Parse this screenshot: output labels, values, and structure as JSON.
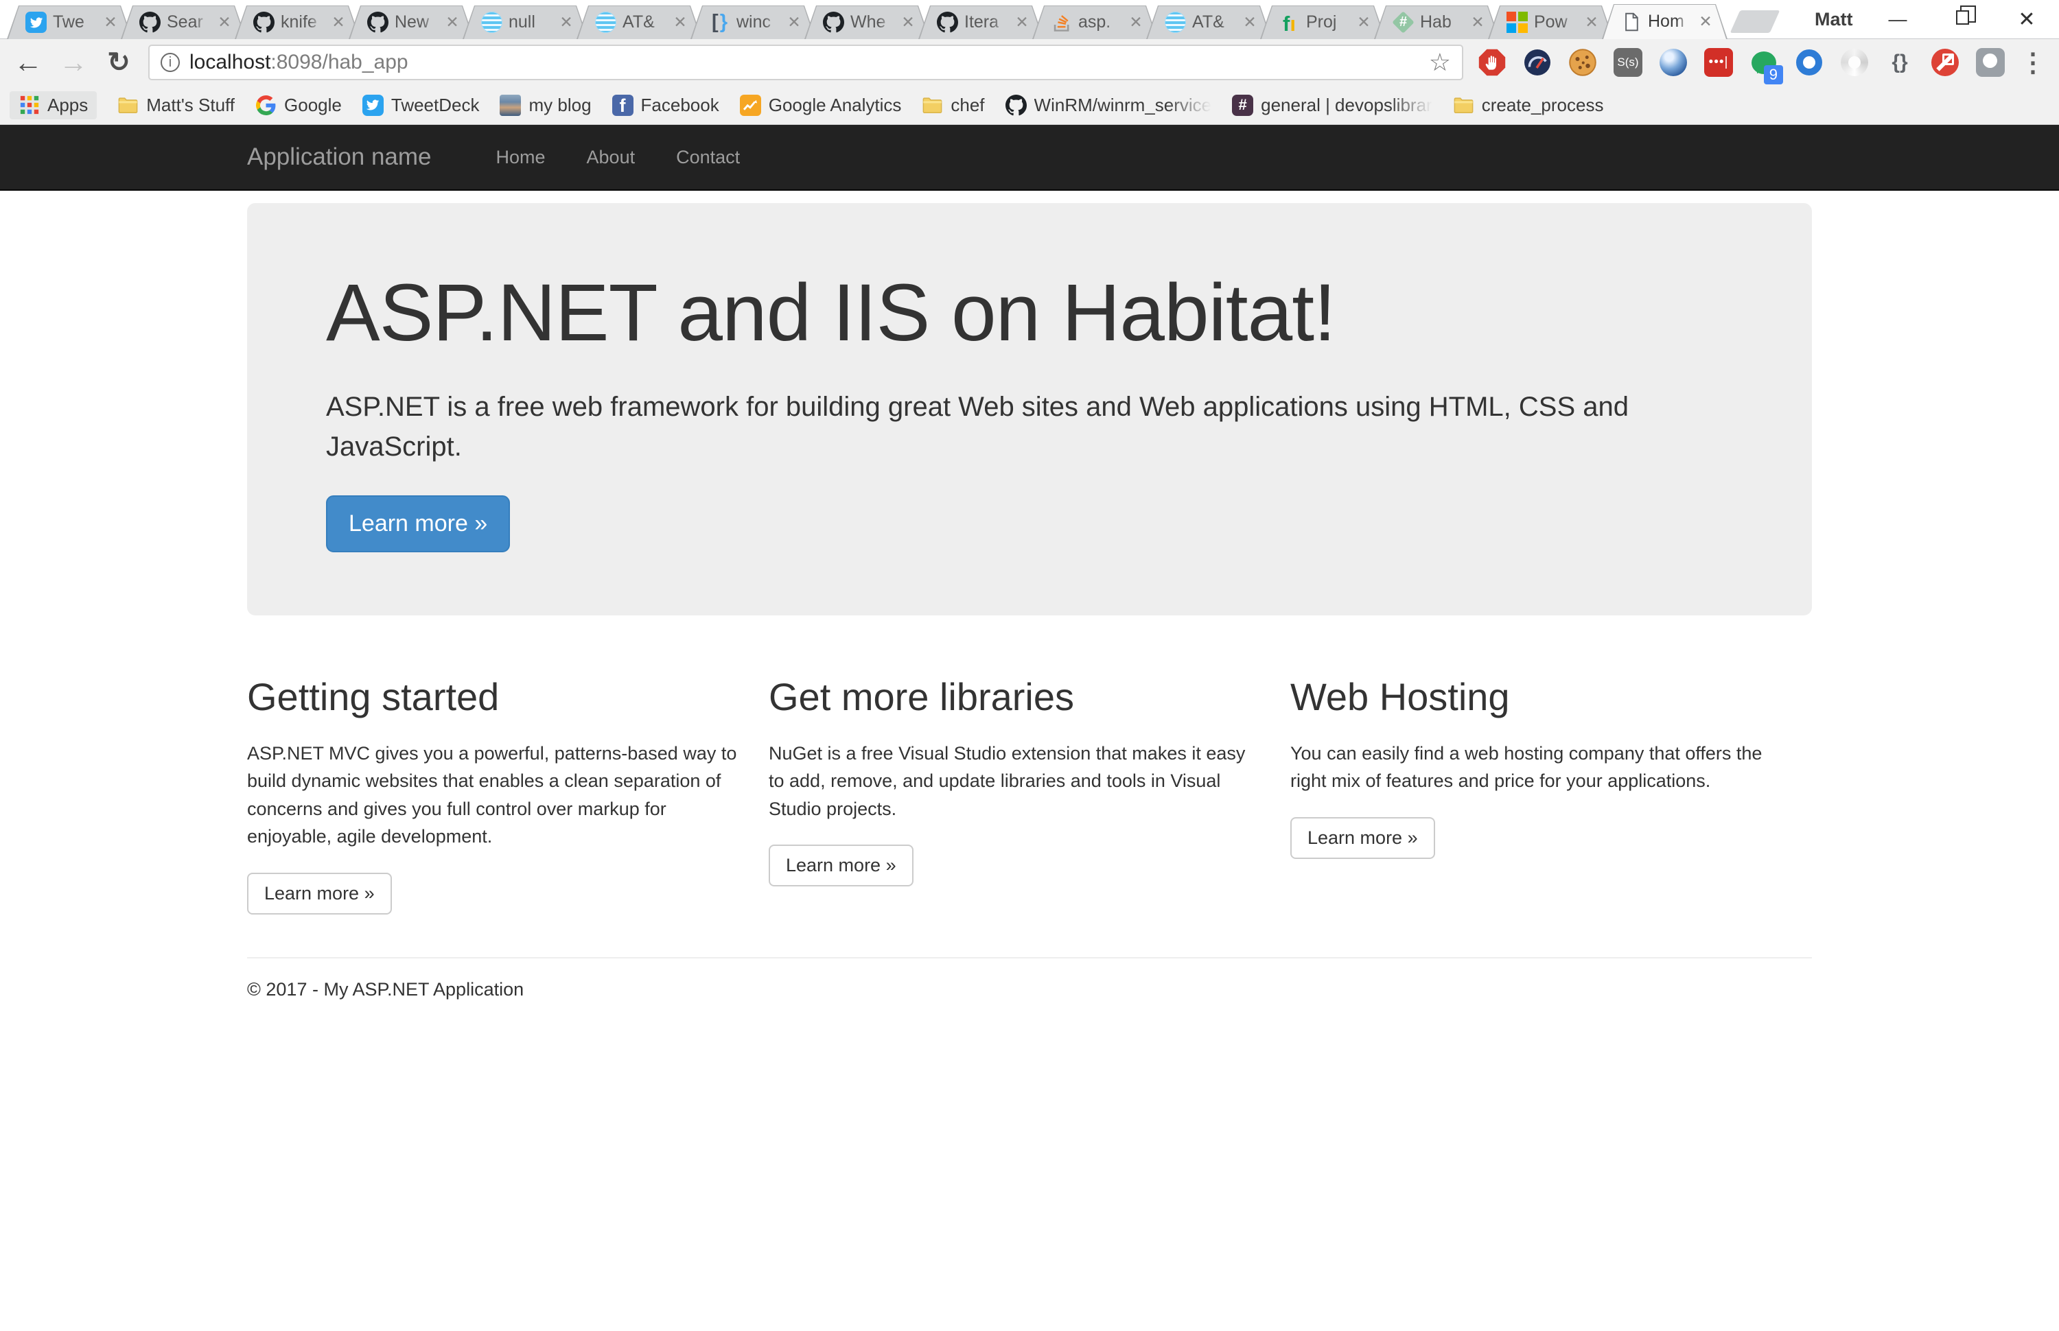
{
  "browser": {
    "window": {
      "profile_name": "Matt"
    },
    "tabs": [
      {
        "title": "Twe",
        "icon": "twitter-icon"
      },
      {
        "title": "Sear",
        "icon": "github-icon"
      },
      {
        "title": "knife",
        "icon": "github-icon"
      },
      {
        "title": "New",
        "icon": "github-icon"
      },
      {
        "title": "null",
        "icon": "att-globe-icon"
      },
      {
        "title": "AT&",
        "icon": "att-globe-icon"
      },
      {
        "title": "winc",
        "icon": "code-brackets-icon"
      },
      {
        "title": "Whe",
        "icon": "github-icon"
      },
      {
        "title": "Itera",
        "icon": "github-icon"
      },
      {
        "title": "asp.",
        "icon": "stackoverflow-icon"
      },
      {
        "title": "AT&",
        "icon": "att-globe-icon"
      },
      {
        "title": "Proj",
        "icon": "project-fi-icon"
      },
      {
        "title": "Hab",
        "icon": "habitat-icon"
      },
      {
        "title": "Pow",
        "icon": "microsoft-icon"
      },
      {
        "title": "Hom",
        "icon": "document-icon",
        "active": true
      }
    ],
    "address": {
      "host": "localhost",
      "path": ":8098/hab_app"
    },
    "toolbar_icons": [
      "back-icon",
      "forward-icon",
      "reload-icon",
      "info-icon",
      "star-icon",
      "menu-icon"
    ],
    "bookmarks": [
      {
        "label": "Apps",
        "icon": "apps-grid-icon"
      },
      {
        "label": "Matt's Stuff",
        "icon": "folder-icon"
      },
      {
        "label": "Google",
        "icon": "google-icon"
      },
      {
        "label": "TweetDeck",
        "icon": "tweetdeck-icon"
      },
      {
        "label": "my blog",
        "icon": "avatar-icon"
      },
      {
        "label": "Facebook",
        "icon": "facebook-icon"
      },
      {
        "label": "Google Analytics",
        "icon": "google-analytics-icon"
      },
      {
        "label": "chef",
        "icon": "folder-icon"
      },
      {
        "label": "WinRM/winrm_service",
        "icon": "github-icon"
      },
      {
        "label": "general | devopslibrar",
        "icon": "slack-icon"
      },
      {
        "label": "create_process",
        "icon": "folder-icon"
      }
    ],
    "extensions": [
      {
        "name": "adblock-icon"
      },
      {
        "name": "speedometer-icon"
      },
      {
        "name": "cookie-icon"
      },
      {
        "name": "sauce-labs-icon",
        "glyph": "S(s)"
      },
      {
        "name": "globe-icon"
      },
      {
        "name": "password-card-icon",
        "glyph": "•••|"
      },
      {
        "name": "chat-bubble-icon",
        "badge": "9"
      },
      {
        "name": "blue-ring-icon"
      },
      {
        "name": "swirl-icon"
      },
      {
        "name": "braces-icon",
        "glyph": "{}"
      },
      {
        "name": "blocked-plugin-icon"
      },
      {
        "name": "screenshot-icon"
      }
    ]
  },
  "page": {
    "colors": {
      "primary": "#428bca",
      "primary_border": "#357ebd",
      "navbar_bg": "#222222",
      "jumbotron_bg": "#eeeeee"
    },
    "navbar": {
      "brand": "Application name",
      "links": [
        "Home",
        "About",
        "Contact"
      ]
    },
    "jumbotron": {
      "title": "ASP.NET and IIS on Habitat!",
      "subtitle": "ASP.NET is a free web framework for building great Web sites and Web applications using HTML, CSS and JavaScript.",
      "cta": "Learn more »"
    },
    "columns": [
      {
        "title": "Getting started",
        "body": "ASP.NET MVC gives you a powerful, patterns-based way to build dynamic websites that enables a clean separation of concerns and gives you full control over markup for enjoyable, agile development.",
        "cta": "Learn more »"
      },
      {
        "title": "Get more libraries",
        "body": "NuGet is a free Visual Studio extension that makes it easy to add, remove, and update libraries and tools in Visual Studio projects.",
        "cta": "Learn more »"
      },
      {
        "title": "Web Hosting",
        "body": "You can easily find a web hosting company that offers the right mix of features and price for your applications.",
        "cta": "Learn more »"
      }
    ],
    "footer": "© 2017 - My ASP.NET Application"
  }
}
